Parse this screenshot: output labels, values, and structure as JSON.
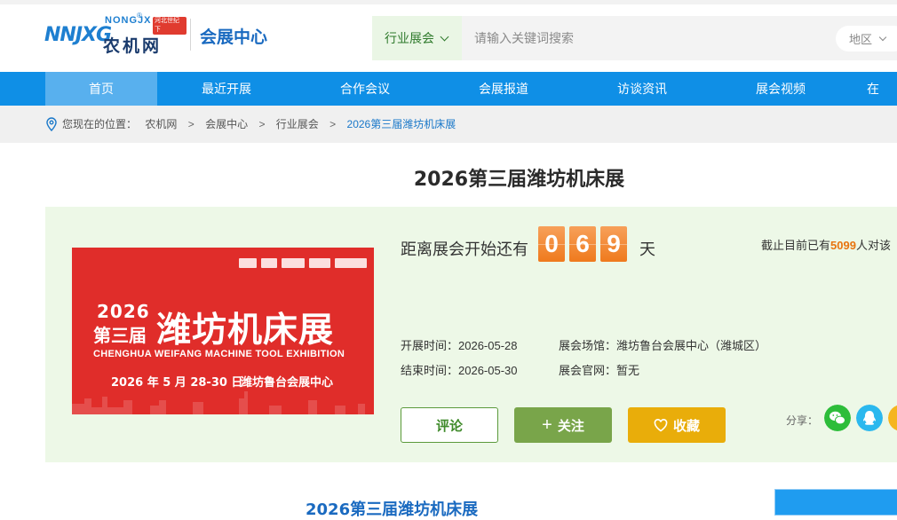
{
  "header": {
    "logo_letters": "NNJXG",
    "logo_en": "NONGJX",
    "logo_tag": "河北世纪下",
    "logo_cn": "农机网",
    "site_section": "会展中心",
    "category_label": "行业展会",
    "search_placeholder": "请输入关键词搜索",
    "region_label": "地区"
  },
  "nav": {
    "items": [
      {
        "label": "首页"
      },
      {
        "label": "最近开展"
      },
      {
        "label": "合作会议"
      },
      {
        "label": "会展报道"
      },
      {
        "label": "访谈资讯"
      },
      {
        "label": "展会视频"
      },
      {
        "label": "在"
      }
    ]
  },
  "breadcrumb": {
    "prefix": "您现在的位置：",
    "items": [
      "农机网",
      "会展中心",
      "行业展会",
      "2026第三届潍坊机床展"
    ],
    "separator": ">"
  },
  "exhibition": {
    "title": "2026第三届潍坊机床展",
    "banner": {
      "year": "2026",
      "edition": "第三届",
      "name": "潍坊机床展",
      "english": "CHENGHUA WEIFANG MACHINE TOOL EXHIBITION",
      "date": "2026 年 5 月 28-30 日",
      "venue": "潍坊鲁台会展中心"
    },
    "countdown_label": "距离展会开始还有",
    "countdown_digits": [
      "0",
      "6",
      "9"
    ],
    "countdown_unit": "天",
    "discuss_prefix": "截止目前已有",
    "discuss_count": "5099",
    "discuss_suffix": "人对该",
    "start_label": "开展时间：",
    "start_date": "2026-05-28",
    "end_label": "结束时间：",
    "end_date": "2026-05-30",
    "venue_label": "展会场馆：",
    "venue": "潍坊鲁台会展中心（潍城区）",
    "website_label": "展会官网：",
    "website": "暂无"
  },
  "actions": {
    "comment": "评论",
    "follow": "关注",
    "favorite": "收藏",
    "share_label": "分享："
  },
  "section": {
    "title": "2026第三届潍坊机床展"
  },
  "colors": {
    "nav_bg": "#0f8fe6",
    "nav_active": "#58b0ee",
    "panel_bg": "#edf8e7",
    "countdown": "#ef7a1d",
    "follow_btn": "#79a54a",
    "fav_btn": "#e9ad0a",
    "banner_red": "#e02d2a"
  }
}
